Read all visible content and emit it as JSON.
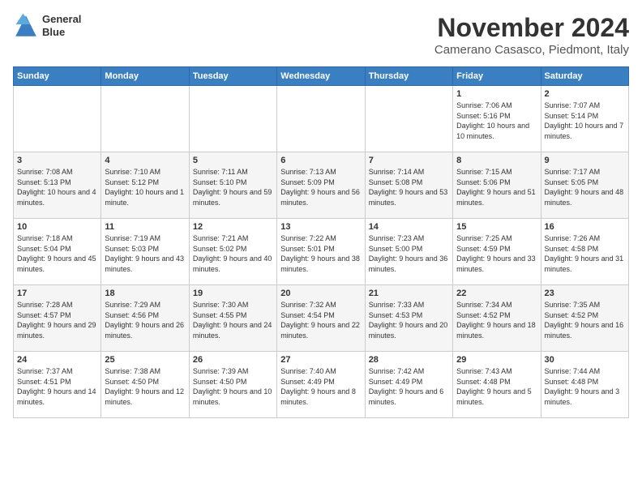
{
  "header": {
    "logo_line1": "General",
    "logo_line2": "Blue",
    "month": "November 2024",
    "location": "Camerano Casasco, Piedmont, Italy"
  },
  "weekdays": [
    "Sunday",
    "Monday",
    "Tuesday",
    "Wednesday",
    "Thursday",
    "Friday",
    "Saturday"
  ],
  "weeks": [
    [
      {
        "day": "",
        "info": ""
      },
      {
        "day": "",
        "info": ""
      },
      {
        "day": "",
        "info": ""
      },
      {
        "day": "",
        "info": ""
      },
      {
        "day": "",
        "info": ""
      },
      {
        "day": "1",
        "info": "Sunrise: 7:06 AM\nSunset: 5:16 PM\nDaylight: 10 hours and 10 minutes."
      },
      {
        "day": "2",
        "info": "Sunrise: 7:07 AM\nSunset: 5:14 PM\nDaylight: 10 hours and 7 minutes."
      }
    ],
    [
      {
        "day": "3",
        "info": "Sunrise: 7:08 AM\nSunset: 5:13 PM\nDaylight: 10 hours and 4 minutes."
      },
      {
        "day": "4",
        "info": "Sunrise: 7:10 AM\nSunset: 5:12 PM\nDaylight: 10 hours and 1 minute."
      },
      {
        "day": "5",
        "info": "Sunrise: 7:11 AM\nSunset: 5:10 PM\nDaylight: 9 hours and 59 minutes."
      },
      {
        "day": "6",
        "info": "Sunrise: 7:13 AM\nSunset: 5:09 PM\nDaylight: 9 hours and 56 minutes."
      },
      {
        "day": "7",
        "info": "Sunrise: 7:14 AM\nSunset: 5:08 PM\nDaylight: 9 hours and 53 minutes."
      },
      {
        "day": "8",
        "info": "Sunrise: 7:15 AM\nSunset: 5:06 PM\nDaylight: 9 hours and 51 minutes."
      },
      {
        "day": "9",
        "info": "Sunrise: 7:17 AM\nSunset: 5:05 PM\nDaylight: 9 hours and 48 minutes."
      }
    ],
    [
      {
        "day": "10",
        "info": "Sunrise: 7:18 AM\nSunset: 5:04 PM\nDaylight: 9 hours and 45 minutes."
      },
      {
        "day": "11",
        "info": "Sunrise: 7:19 AM\nSunset: 5:03 PM\nDaylight: 9 hours and 43 minutes."
      },
      {
        "day": "12",
        "info": "Sunrise: 7:21 AM\nSunset: 5:02 PM\nDaylight: 9 hours and 40 minutes."
      },
      {
        "day": "13",
        "info": "Sunrise: 7:22 AM\nSunset: 5:01 PM\nDaylight: 9 hours and 38 minutes."
      },
      {
        "day": "14",
        "info": "Sunrise: 7:23 AM\nSunset: 5:00 PM\nDaylight: 9 hours and 36 minutes."
      },
      {
        "day": "15",
        "info": "Sunrise: 7:25 AM\nSunset: 4:59 PM\nDaylight: 9 hours and 33 minutes."
      },
      {
        "day": "16",
        "info": "Sunrise: 7:26 AM\nSunset: 4:58 PM\nDaylight: 9 hours and 31 minutes."
      }
    ],
    [
      {
        "day": "17",
        "info": "Sunrise: 7:28 AM\nSunset: 4:57 PM\nDaylight: 9 hours and 29 minutes."
      },
      {
        "day": "18",
        "info": "Sunrise: 7:29 AM\nSunset: 4:56 PM\nDaylight: 9 hours and 26 minutes."
      },
      {
        "day": "19",
        "info": "Sunrise: 7:30 AM\nSunset: 4:55 PM\nDaylight: 9 hours and 24 minutes."
      },
      {
        "day": "20",
        "info": "Sunrise: 7:32 AM\nSunset: 4:54 PM\nDaylight: 9 hours and 22 minutes."
      },
      {
        "day": "21",
        "info": "Sunrise: 7:33 AM\nSunset: 4:53 PM\nDaylight: 9 hours and 20 minutes."
      },
      {
        "day": "22",
        "info": "Sunrise: 7:34 AM\nSunset: 4:52 PM\nDaylight: 9 hours and 18 minutes."
      },
      {
        "day": "23",
        "info": "Sunrise: 7:35 AM\nSunset: 4:52 PM\nDaylight: 9 hours and 16 minutes."
      }
    ],
    [
      {
        "day": "24",
        "info": "Sunrise: 7:37 AM\nSunset: 4:51 PM\nDaylight: 9 hours and 14 minutes."
      },
      {
        "day": "25",
        "info": "Sunrise: 7:38 AM\nSunset: 4:50 PM\nDaylight: 9 hours and 12 minutes."
      },
      {
        "day": "26",
        "info": "Sunrise: 7:39 AM\nSunset: 4:50 PM\nDaylight: 9 hours and 10 minutes."
      },
      {
        "day": "27",
        "info": "Sunrise: 7:40 AM\nSunset: 4:49 PM\nDaylight: 9 hours and 8 minutes."
      },
      {
        "day": "28",
        "info": "Sunrise: 7:42 AM\nSunset: 4:49 PM\nDaylight: 9 hours and 6 minutes."
      },
      {
        "day": "29",
        "info": "Sunrise: 7:43 AM\nSunset: 4:48 PM\nDaylight: 9 hours and 5 minutes."
      },
      {
        "day": "30",
        "info": "Sunrise: 7:44 AM\nSunset: 4:48 PM\nDaylight: 9 hours and 3 minutes."
      }
    ]
  ]
}
